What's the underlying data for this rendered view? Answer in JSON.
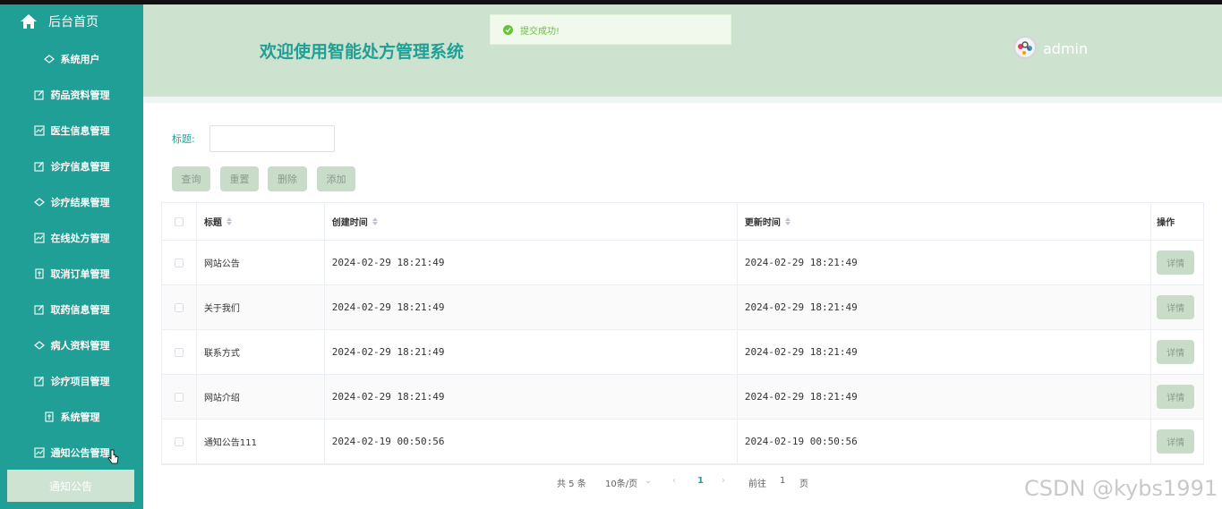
{
  "sidebar": {
    "home_label": "后台首页",
    "items": [
      {
        "label": "系统用户",
        "icon": "diamond-icon"
      },
      {
        "label": "药品资料管理",
        "icon": "edit-icon"
      },
      {
        "label": "医生信息管理",
        "icon": "chart-icon"
      },
      {
        "label": "诊疗信息管理",
        "icon": "edit-icon"
      },
      {
        "label": "诊疗结果管理",
        "icon": "diamond-icon"
      },
      {
        "label": "在线处方管理",
        "icon": "chart-icon"
      },
      {
        "label": "取消订单管理",
        "icon": "document-icon"
      },
      {
        "label": "取药信息管理",
        "icon": "edit-icon"
      },
      {
        "label": "病人资料管理",
        "icon": "diamond-icon"
      },
      {
        "label": "诊疗项目管理",
        "icon": "edit-icon"
      },
      {
        "label": "系统管理",
        "icon": "document-icon"
      },
      {
        "label": "通知公告管理",
        "icon": "chart-icon"
      }
    ],
    "sub_item": "通知公告"
  },
  "header": {
    "title": "欢迎使用智能处方管理系统",
    "username": "admin"
  },
  "toast": {
    "message": "提交成功!"
  },
  "search": {
    "title_label": "标题:",
    "title_value": "",
    "buttons": {
      "query": "查询",
      "reset": "重置",
      "delete": "删除",
      "add": "添加"
    }
  },
  "table": {
    "headers": {
      "title": "标题",
      "created": "创建时间",
      "updated": "更新时间",
      "ops": "操作"
    },
    "detail_label": "详情",
    "rows": [
      {
        "title": "网站公告",
        "created": "2024-02-29 18:21:49",
        "updated": "2024-02-29 18:21:49"
      },
      {
        "title": "关于我们",
        "created": "2024-02-29 18:21:49",
        "updated": "2024-02-29 18:21:49"
      },
      {
        "title": "联系方式",
        "created": "2024-02-29 18:21:49",
        "updated": "2024-02-29 18:21:49"
      },
      {
        "title": "网站介绍",
        "created": "2024-02-29 18:21:49",
        "updated": "2024-02-29 18:21:49"
      },
      {
        "title": "通知公告111",
        "created": "2024-02-19 00:50:56",
        "updated": "2024-02-19 00:50:56"
      }
    ]
  },
  "pagination": {
    "total": "共 5 条",
    "page_size": "10条/页",
    "current_page": "1",
    "goto_prefix": "前往",
    "goto_value": "1",
    "goto_suffix": "页"
  },
  "watermark": "CSDN @kybs1991",
  "colors": {
    "sidebar": "#1f9f95",
    "header": "#cde3cf",
    "button": "#c8dcc9"
  }
}
